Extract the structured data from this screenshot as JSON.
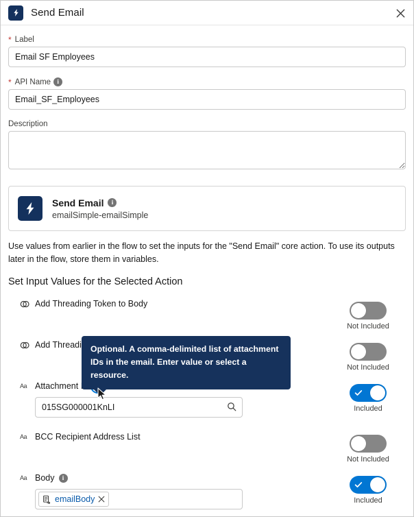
{
  "header": {
    "title": "Send Email",
    "icon": "lightning-bolt-icon",
    "close_label": "Close"
  },
  "form": {
    "label_field": {
      "label": "Label",
      "required": true,
      "value": "Email SF Employees"
    },
    "api_name_field": {
      "label": "API Name",
      "required": true,
      "value": "Email_SF_Employees",
      "has_info": true
    },
    "description_field": {
      "label": "Description",
      "value": "",
      "placeholder": ""
    }
  },
  "action_card": {
    "title": "Send Email",
    "subtitle": "emailSimple-emailSimple",
    "has_info": true,
    "icon": "lightning-bolt-icon"
  },
  "description_paragraph": "Use values from earlier in the flow to set the inputs for the \"Send Email\" core action. To use its outputs later in the flow, store them in variables.",
  "section_title": "Set Input Values for the Selected Action",
  "toggle_labels": {
    "on": "Included",
    "off": "Not Included"
  },
  "rows": [
    {
      "label": "Add Threading Token to Body",
      "type_icon": "boolean-icon",
      "has_info": false,
      "toggle": "off",
      "toggle_label": "Not Included",
      "input": null
    },
    {
      "label": "Add Threadin",
      "type_icon": "boolean-icon",
      "has_info": false,
      "toggle": "off",
      "toggle_label": "Not Included",
      "input": null
    },
    {
      "label": "Attachment ID",
      "type_icon": "text-icon",
      "has_info": true,
      "info_focused": true,
      "toggle": "on",
      "toggle_label": "Included",
      "input": {
        "kind": "combobox",
        "value": "015SG000001KnLI",
        "placeholder": "",
        "icon": "search-icon"
      }
    },
    {
      "label": "BCC Recipient Address List",
      "type_icon": "text-icon",
      "has_info": false,
      "toggle": "off",
      "toggle_label": "Not Included",
      "input": null
    },
    {
      "label": "Body",
      "type_icon": "text-icon",
      "has_info": true,
      "toggle": "on",
      "toggle_label": "Included",
      "input": {
        "kind": "pill",
        "pill_text": "emailBody",
        "pill_icon": "record-variable-icon",
        "remove_label": "Remove"
      }
    }
  ],
  "tooltip": {
    "text": "Optional. A comma-delimited list of attachment IDs in the email. Enter value or select a resource.",
    "target": "attachment-id-info-icon"
  },
  "colors": {
    "brand_blue": "#0176d3",
    "dark_navy": "#14315d",
    "tooltip_bg": "#16325c",
    "required_red": "#c23934",
    "link_blue": "#0b5cab",
    "toggle_off_gray": "#868686"
  }
}
